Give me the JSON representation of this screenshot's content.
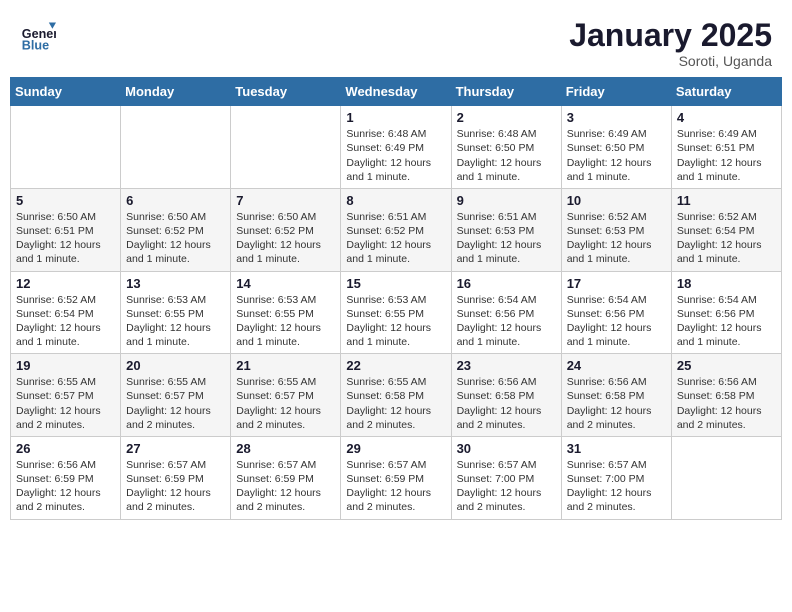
{
  "logo": {
    "line1": "General",
    "line2": "Blue"
  },
  "title": "January 2025",
  "location": "Soroti, Uganda",
  "weekdays": [
    "Sunday",
    "Monday",
    "Tuesday",
    "Wednesday",
    "Thursday",
    "Friday",
    "Saturday"
  ],
  "weeks": [
    [
      {
        "day": "",
        "info": ""
      },
      {
        "day": "",
        "info": ""
      },
      {
        "day": "",
        "info": ""
      },
      {
        "day": "1",
        "info": "Sunrise: 6:48 AM\nSunset: 6:49 PM\nDaylight: 12 hours\nand 1 minute."
      },
      {
        "day": "2",
        "info": "Sunrise: 6:48 AM\nSunset: 6:50 PM\nDaylight: 12 hours\nand 1 minute."
      },
      {
        "day": "3",
        "info": "Sunrise: 6:49 AM\nSunset: 6:50 PM\nDaylight: 12 hours\nand 1 minute."
      },
      {
        "day": "4",
        "info": "Sunrise: 6:49 AM\nSunset: 6:51 PM\nDaylight: 12 hours\nand 1 minute."
      }
    ],
    [
      {
        "day": "5",
        "info": "Sunrise: 6:50 AM\nSunset: 6:51 PM\nDaylight: 12 hours\nand 1 minute."
      },
      {
        "day": "6",
        "info": "Sunrise: 6:50 AM\nSunset: 6:52 PM\nDaylight: 12 hours\nand 1 minute."
      },
      {
        "day": "7",
        "info": "Sunrise: 6:50 AM\nSunset: 6:52 PM\nDaylight: 12 hours\nand 1 minute."
      },
      {
        "day": "8",
        "info": "Sunrise: 6:51 AM\nSunset: 6:52 PM\nDaylight: 12 hours\nand 1 minute."
      },
      {
        "day": "9",
        "info": "Sunrise: 6:51 AM\nSunset: 6:53 PM\nDaylight: 12 hours\nand 1 minute."
      },
      {
        "day": "10",
        "info": "Sunrise: 6:52 AM\nSunset: 6:53 PM\nDaylight: 12 hours\nand 1 minute."
      },
      {
        "day": "11",
        "info": "Sunrise: 6:52 AM\nSunset: 6:54 PM\nDaylight: 12 hours\nand 1 minute."
      }
    ],
    [
      {
        "day": "12",
        "info": "Sunrise: 6:52 AM\nSunset: 6:54 PM\nDaylight: 12 hours\nand 1 minute."
      },
      {
        "day": "13",
        "info": "Sunrise: 6:53 AM\nSunset: 6:55 PM\nDaylight: 12 hours\nand 1 minute."
      },
      {
        "day": "14",
        "info": "Sunrise: 6:53 AM\nSunset: 6:55 PM\nDaylight: 12 hours\nand 1 minute."
      },
      {
        "day": "15",
        "info": "Sunrise: 6:53 AM\nSunset: 6:55 PM\nDaylight: 12 hours\nand 1 minute."
      },
      {
        "day": "16",
        "info": "Sunrise: 6:54 AM\nSunset: 6:56 PM\nDaylight: 12 hours\nand 1 minute."
      },
      {
        "day": "17",
        "info": "Sunrise: 6:54 AM\nSunset: 6:56 PM\nDaylight: 12 hours\nand 1 minute."
      },
      {
        "day": "18",
        "info": "Sunrise: 6:54 AM\nSunset: 6:56 PM\nDaylight: 12 hours\nand 1 minute."
      }
    ],
    [
      {
        "day": "19",
        "info": "Sunrise: 6:55 AM\nSunset: 6:57 PM\nDaylight: 12 hours\nand 2 minutes."
      },
      {
        "day": "20",
        "info": "Sunrise: 6:55 AM\nSunset: 6:57 PM\nDaylight: 12 hours\nand 2 minutes."
      },
      {
        "day": "21",
        "info": "Sunrise: 6:55 AM\nSunset: 6:57 PM\nDaylight: 12 hours\nand 2 minutes."
      },
      {
        "day": "22",
        "info": "Sunrise: 6:55 AM\nSunset: 6:58 PM\nDaylight: 12 hours\nand 2 minutes."
      },
      {
        "day": "23",
        "info": "Sunrise: 6:56 AM\nSunset: 6:58 PM\nDaylight: 12 hours\nand 2 minutes."
      },
      {
        "day": "24",
        "info": "Sunrise: 6:56 AM\nSunset: 6:58 PM\nDaylight: 12 hours\nand 2 minutes."
      },
      {
        "day": "25",
        "info": "Sunrise: 6:56 AM\nSunset: 6:58 PM\nDaylight: 12 hours\nand 2 minutes."
      }
    ],
    [
      {
        "day": "26",
        "info": "Sunrise: 6:56 AM\nSunset: 6:59 PM\nDaylight: 12 hours\nand 2 minutes."
      },
      {
        "day": "27",
        "info": "Sunrise: 6:57 AM\nSunset: 6:59 PM\nDaylight: 12 hours\nand 2 minutes."
      },
      {
        "day": "28",
        "info": "Sunrise: 6:57 AM\nSunset: 6:59 PM\nDaylight: 12 hours\nand 2 minutes."
      },
      {
        "day": "29",
        "info": "Sunrise: 6:57 AM\nSunset: 6:59 PM\nDaylight: 12 hours\nand 2 minutes."
      },
      {
        "day": "30",
        "info": "Sunrise: 6:57 AM\nSunset: 7:00 PM\nDaylight: 12 hours\nand 2 minutes."
      },
      {
        "day": "31",
        "info": "Sunrise: 6:57 AM\nSunset: 7:00 PM\nDaylight: 12 hours\nand 2 minutes."
      },
      {
        "day": "",
        "info": ""
      }
    ]
  ]
}
